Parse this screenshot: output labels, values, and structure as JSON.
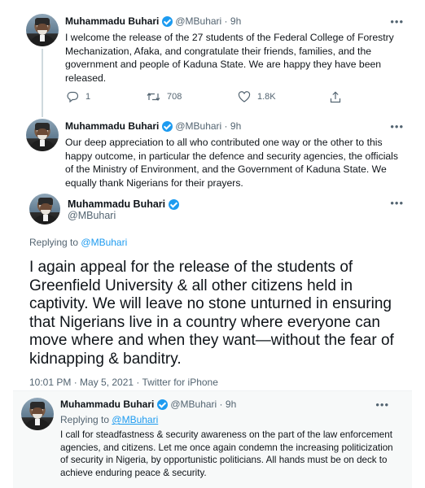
{
  "tweets": [
    {
      "name": "Muhammadu Buhari",
      "handle": "@MBuhari",
      "time": "9h",
      "more": "•••",
      "text": "I welcome the release of the 27 students of the Federal College of Forestry Mechanization, Afaka, and congratulate their friends, families, and the government and people of Kaduna State. We are happy they have been released.",
      "reply_count": "1",
      "retweet_count": "708",
      "like_count": "1.8K"
    },
    {
      "name": "Muhammadu Buhari",
      "handle": "@MBuhari",
      "time": "9h",
      "more": "•••",
      "text": "Our deep appreciation to all who contributed one way or the other to this happy outcome, in particular the defence and security agencies, the officials of the Ministry of Environment, and the Government of Kaduna State. We equally thank Nigerians for their prayers."
    }
  ],
  "main_tweet": {
    "name": "Muhammadu Buhari",
    "handle": "@MBuhari",
    "more": "•••",
    "replying_prefix": "Replying to",
    "replying_to": "@MBuhari",
    "text": "I again appeal for the release of the students of Greenfield University & all other citizens held in captivity. We will leave no stone unturned in ensuring that Nigerians live in a country where everyone can move where and when they want—without the fear of kidnapping & banditry.",
    "meta": "10:01 PM · May 5, 2021 · Twitter for iPhone"
  },
  "reply_tweet": {
    "name": "Muhammadu Buhari",
    "handle": "@MBuhari",
    "time": "9h",
    "more": "•••",
    "replying_prefix": "Replying to",
    "replying_to": "@MBuhari",
    "text": "I call for steadfastness & security awareness on the part of the law enforcement agencies, and citizens. Let me once again condemn the increasing politicization of security in Nigeria, by opportunistic politicians. All hands must be on deck to achieve enduring peace & security."
  },
  "colors": {
    "accent": "#1d9bf0",
    "secondary_text": "#536471",
    "primary_text": "#0f1419"
  },
  "icons": [
    "reply-icon",
    "retweet-icon",
    "like-icon",
    "share-icon",
    "verified-badge-icon",
    "more-icon"
  ]
}
